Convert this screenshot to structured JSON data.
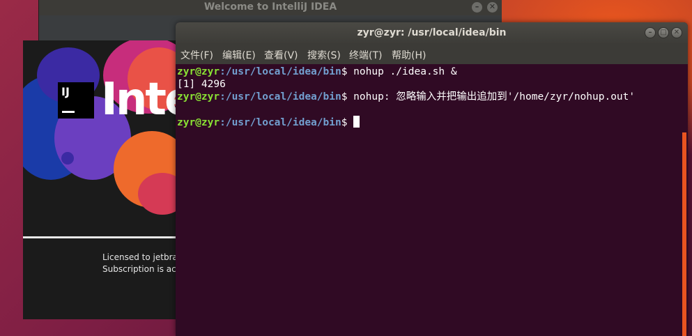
{
  "welcome_window": {
    "title": "Welcome to IntelliJ IDEA"
  },
  "splash": {
    "logo_letters": "IJ",
    "wordmark": "Inte",
    "license_line1": "Licensed to jetbrain",
    "license_line2": "Subscription is activ"
  },
  "terminal": {
    "title": "zyr@zyr: /usr/local/idea/bin",
    "menu": [
      "文件(F)",
      "编辑(E)",
      "查看(V)",
      "搜索(S)",
      "终端(T)",
      "帮助(H)"
    ],
    "prompt_user": "zyr@zyr",
    "prompt_path": ":/usr/local/idea/bin",
    "prompt_symbol": "$",
    "lines": {
      "l1_cmd": " nohup ./idea.sh &",
      "l2_out": "[1] 4296",
      "l3_msg": " nohup: 忽略输入并把输出追加到'/home/zyr/nohup.out'"
    }
  },
  "colors": {
    "terminal_bg": "#300a24",
    "prompt_user": "#8ae234",
    "prompt_path": "#729fcf",
    "accent": "#e95420"
  }
}
